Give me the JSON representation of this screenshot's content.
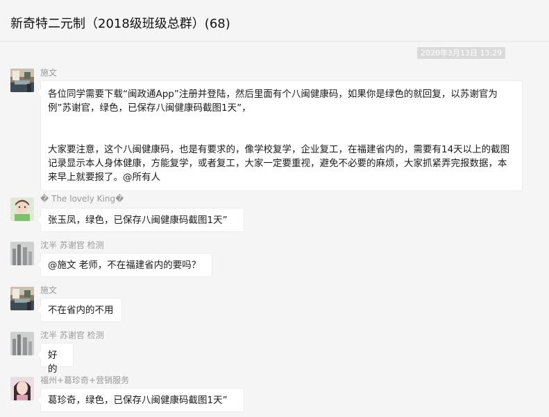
{
  "header": {
    "title": "新奇特二元制（2018级班级总群）(68)"
  },
  "timestamp": "2020年3月13日 13:29",
  "messages": [
    {
      "sender": "施文",
      "avatar": "room-avatar",
      "paragraphs": [
        "各位同学需要下载“闽政通App”注册并登陆，然后里面有个八闽健康码，如果你是绿色的就回复，以苏谢官为例”苏谢官，绿色，已保存八闽健康码截图1天”，",
        "大家要注意，这个八闽健康码，也是有要求的，像学校复学，企业复工，在福建省内的，需要有14天以上的截图记录显示本人身体健康，方能复学，或者复工，大家一定要重视，避免不必要的麻烦，大家抓紧弄完报数据，本来早上就要报了。@所有人"
      ]
    },
    {
      "sender": "� The lovely King�",
      "avatar": "child-avatar",
      "text": "张玉凤，绿色，已保存八闽健康码截图1天”"
    },
    {
      "sender": "沈半 苏谢官 检测",
      "avatar": "city-avatar",
      "text": "@施文 老师，不在福建省内的要吗？"
    },
    {
      "sender": "施文",
      "avatar": "room-avatar",
      "text": "不在省内的不用"
    },
    {
      "sender": "沈半 苏谢官 检测",
      "avatar": "city-avatar",
      "text": "好的"
    },
    {
      "sender": "福州+葛珍奇+营销服务",
      "avatar": "girl-avatar",
      "text": "葛珍奇，绿色，已保存八闽健康码截图1天”"
    }
  ]
}
